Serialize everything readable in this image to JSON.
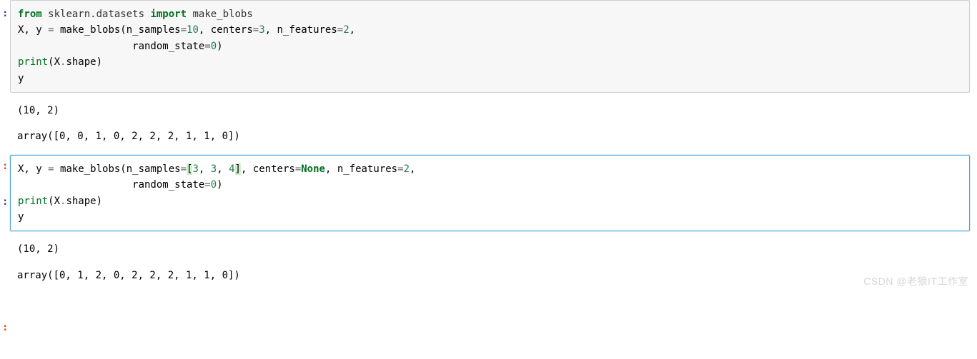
{
  "prompts": {
    "in_marker": ":",
    "out_marker": ":"
  },
  "cell1": {
    "line1": {
      "from": "from",
      "pkg": "sklearn.datasets",
      "import": "import",
      "name": "make_blobs"
    },
    "line2": {
      "lhs": "X, y ",
      "eq": "=",
      "fn": " make_blobs(n_samples",
      "eq2": "=",
      "n_samples": "10",
      "c1": ", centers",
      "eq3": "=",
      "centers": "3",
      "c2": ", n_features",
      "eq4": "=",
      "n_features": "2",
      "comma_end": ","
    },
    "line3": {
      "indent": "                   random_state",
      "eq": "=",
      "rs": "0",
      "close": ")"
    },
    "line4": {
      "print": "print",
      "open": "(X",
      "dot": ".",
      "shape": "shape",
      "close": ")"
    },
    "line5": "y"
  },
  "out1": {
    "shape": "(10, 2)",
    "array": "array([0, 0, 1, 0, 2, 2, 2, 1, 1, 0])"
  },
  "cell2": {
    "line1": {
      "lhs": "X, y ",
      "eq": "=",
      "fn": " make_blobs(n_samples",
      "eq2": "=",
      "lbr": "[",
      "v1": "3",
      "s1": ", ",
      "v2": "3",
      "s2": ", ",
      "v3": "4",
      "rbr": "]",
      "c1": ", centers",
      "eq3": "=",
      "none": "None",
      "c2": ", n_features",
      "eq4": "=",
      "n_features": "2",
      "comma_end": ","
    },
    "line2": {
      "indent": "                   random_state",
      "eq": "=",
      "rs": "0",
      "close": ")"
    },
    "line3": {
      "print": "print",
      "open": "(X",
      "dot": ".",
      "shape": "shape",
      "close": ")"
    },
    "line4": "y"
  },
  "out2": {
    "shape": "(10, 2)",
    "array": "array([0, 1, 2, 0, 2, 2, 2, 1, 1, 0])"
  },
  "watermark": "CSDN @老狼IT工作室"
}
